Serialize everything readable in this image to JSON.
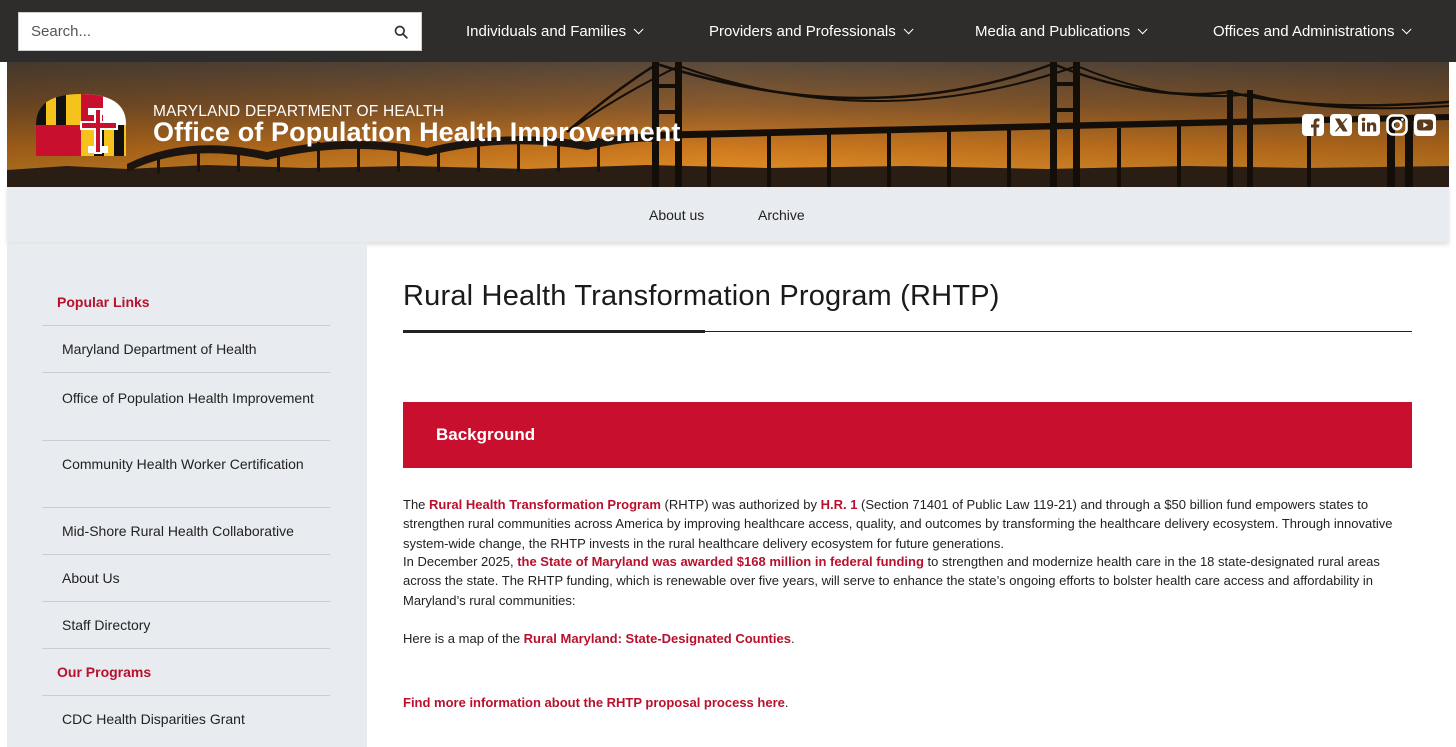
{
  "search": {
    "placeholder": "Search..."
  },
  "topnav": [
    {
      "label": "Individuals and Families"
    },
    {
      "label": "Providers and Professionals"
    },
    {
      "label": "Media and Publications"
    },
    {
      "label": "Offices and Administrations"
    }
  ],
  "header": {
    "department": "MARYLAND DEPARTMENT OF HEALTH",
    "office": "Office of Population Health Improvement"
  },
  "social_icons": [
    "facebook-icon",
    "x-icon",
    "linkedin-icon",
    "instagram-icon",
    "youtube-icon"
  ],
  "subnav": [
    {
      "label": "About us"
    },
    {
      "label": "Archive"
    }
  ],
  "sidebar": {
    "popular_heading": "Popular Links",
    "items": [
      {
        "label": "Maryland Department of Health"
      },
      {
        "label": "Office of Population Health Improvement"
      },
      {
        "label": "Community Health Worker Certification"
      },
      {
        "label": "Mid-Shore Rural Health Collaborative"
      },
      {
        "label": "About Us"
      },
      {
        "label": "Staff Directory"
      }
    ],
    "programs_heading": "Our Programs",
    "program_items": [
      {
        "label": "CDC Health Disparities Grant"
      }
    ]
  },
  "main": {
    "title": "Rural Health Transformation Program (RHTP)",
    "section_heading": "Background",
    "p1": {
      "pre": "The ",
      "link1": "Rural Health Transformation Program",
      "mid1": " (RHTP) was authorized by ",
      "link2": "H.R. 1",
      "post": " (Section 71401 of Public Law 119-21) and through a $50 billion fund empowers states to strengthen rural communities across America by improving healthcare access, quality, and outcomes by transforming the healthcare delivery ecosystem. Through innovative system-wide change, the RHTP invests in the rural healthcare delivery ecosystem for future generations."
    },
    "p2": {
      "pre": "In December 2025, ",
      "link": "the State of Maryland was awarded $168 million in federal funding",
      "post": " to strengthen and modernize health care in the 18 state-designated rural areas across the state. The RHTP funding, which is renewable over five years, will serve to enhance the state’s ongoing efforts to bolster health care access and affordability in Maryland’s rural communities:"
    },
    "p3": {
      "pre": "Here is a map of the ",
      "link": "Rural Maryland: State-Designated Counties",
      "post": "."
    },
    "p4": {
      "link": "Find more information about the RHTP proposal process here",
      "post": "."
    }
  },
  "colors": {
    "accent_red": "#c8102e",
    "topbar": "#2f2d2b",
    "sidebar_bg": "#e8ebef"
  }
}
